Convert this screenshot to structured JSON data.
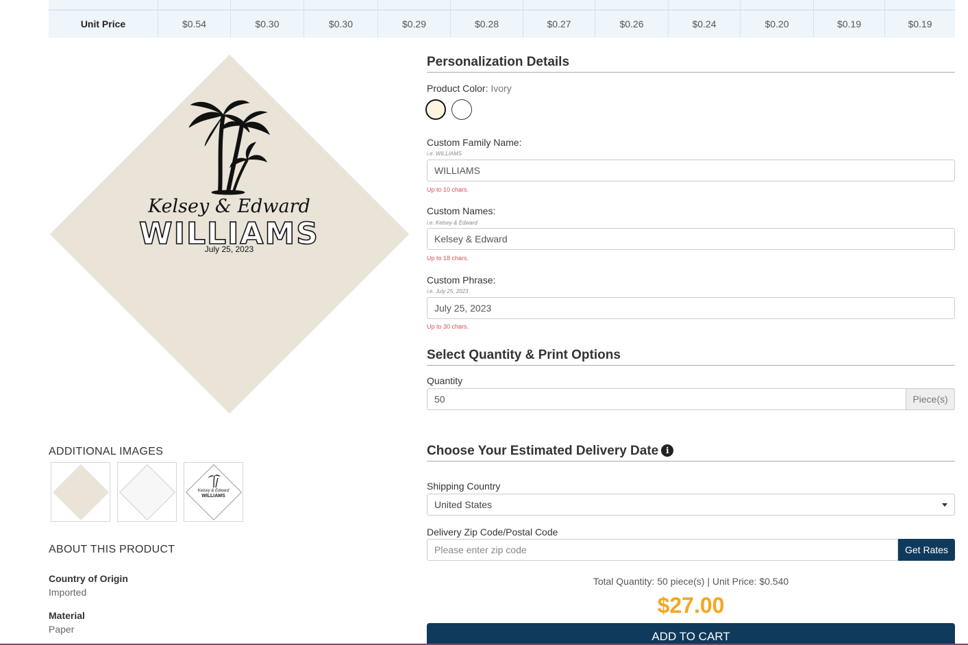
{
  "price_table": {
    "row_label": "Unit Price",
    "prices": [
      "$0.54",
      "$0.30",
      "$0.30",
      "$0.29",
      "$0.28",
      "$0.27",
      "$0.26",
      "$0.24",
      "$0.20",
      "$0.19",
      "$0.19"
    ]
  },
  "product_preview": {
    "names": "Kelsey & Edward",
    "family": "WILLIAMS",
    "phrase": "July 25, 2023"
  },
  "additional_images": {
    "label": "ADDITIONAL IMAGES",
    "thumb_mini_names": "Kelsey & Edward",
    "thumb_mini_family": "WILLIAMS"
  },
  "about": {
    "label": "ABOUT THIS PRODUCT",
    "items": [
      {
        "key": "Country of Origin",
        "value": "Imported"
      },
      {
        "key": "Material",
        "value": "Paper"
      }
    ]
  },
  "personalization": {
    "heading": "Personalization Details",
    "color_label": "Product Color:",
    "color_value": "Ivory",
    "swatches": [
      {
        "name": "Ivory",
        "color": "#fdf6dc",
        "selected": true
      },
      {
        "name": "White",
        "color": "#ffffff",
        "selected": false
      }
    ],
    "fields": [
      {
        "label": "Custom Family Name:",
        "hint": "i.e. WILLIAMS",
        "value": "WILLIAMS",
        "limit": "Up to 10 chars."
      },
      {
        "label": "Custom Names:",
        "hint": "i.e. Kelsey & Edward",
        "value": "Kelsey & Edward",
        "limit": "Up to 18 chars."
      },
      {
        "label": "Custom Phrase:",
        "hint": "i.e. July 25, 2023",
        "value": "July 25, 2023",
        "limit": "Up to 30 chars."
      }
    ]
  },
  "quantity": {
    "heading": "Select Quantity & Print Options",
    "label": "Quantity",
    "value": "50",
    "unit": "Piece(s)"
  },
  "delivery": {
    "heading": "Choose Your Estimated Delivery Date",
    "info_icon": "i",
    "country_label": "Shipping Country",
    "country_value": "United States",
    "zip_label": "Delivery Zip Code/Postal Code",
    "zip_placeholder": "Please enter zip code",
    "get_rates": "Get Rates"
  },
  "summary": {
    "text": "Total Quantity: 50 piece(s) | Unit Price: $0.540",
    "total": "$27.00",
    "add_to_cart": "ADD TO CART"
  },
  "colors": {
    "accent_price": "#f5a623",
    "button_navy": "#0f3a5c",
    "limit_red": "#d9534f",
    "napkin_ivory": "#e9e3d8"
  }
}
